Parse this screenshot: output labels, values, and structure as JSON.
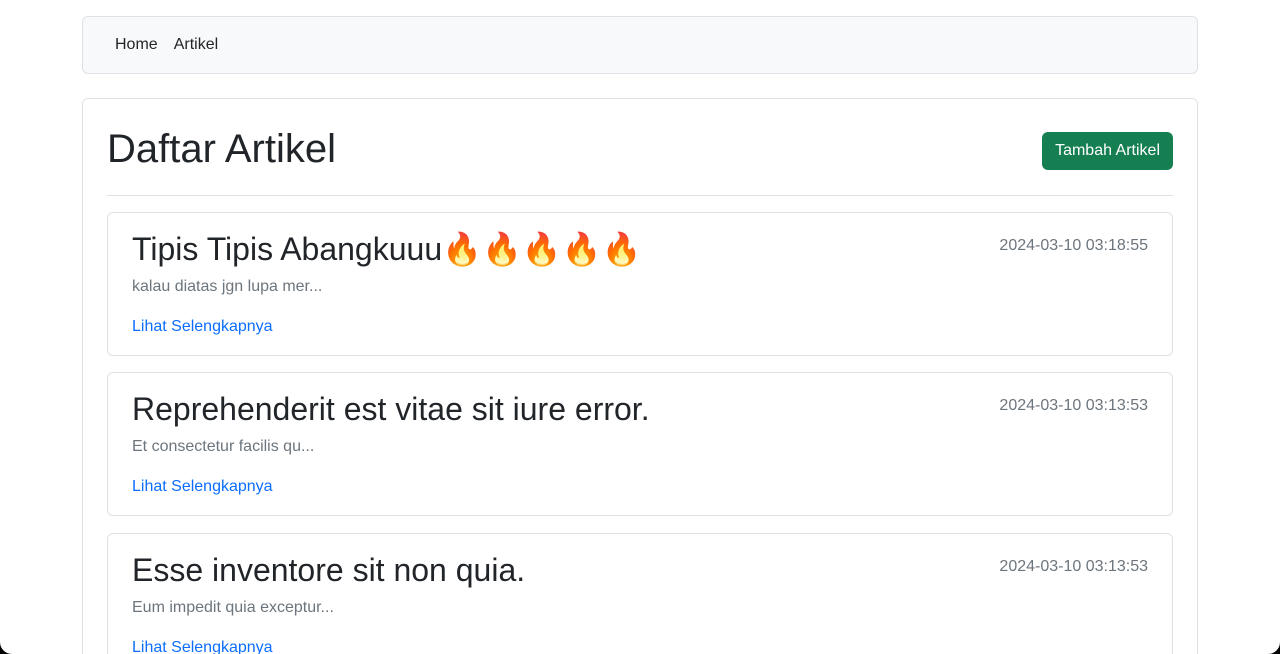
{
  "nav": {
    "home_label": "Home",
    "artikel_label": "Artikel"
  },
  "page": {
    "title": "Daftar Artikel",
    "add_button_label": "Tambah Artikel"
  },
  "colors": {
    "primary_button": "#157f52",
    "link": "#0d6efd",
    "muted_text": "#6c757d",
    "border": "#dee2e6",
    "navbar_bg": "#f8f9fa"
  },
  "articles": [
    {
      "title": "Tipis Tipis Abangkuuu🔥🔥🔥🔥🔥",
      "date": "2024-03-10 03:18:55",
      "excerpt": "kalau diatas jgn lupa mer...",
      "link_label": "Lihat Selengkapnya"
    },
    {
      "title": "Reprehenderit est vitae sit iure error.",
      "date": "2024-03-10 03:13:53",
      "excerpt": "Et consectetur facilis qu...",
      "link_label": "Lihat Selengkapnya"
    },
    {
      "title": "Esse inventore sit non quia.",
      "date": "2024-03-10 03:13:53",
      "excerpt": "Eum impedit quia exceptur...",
      "link_label": "Lihat Selengkapnya"
    }
  ]
}
